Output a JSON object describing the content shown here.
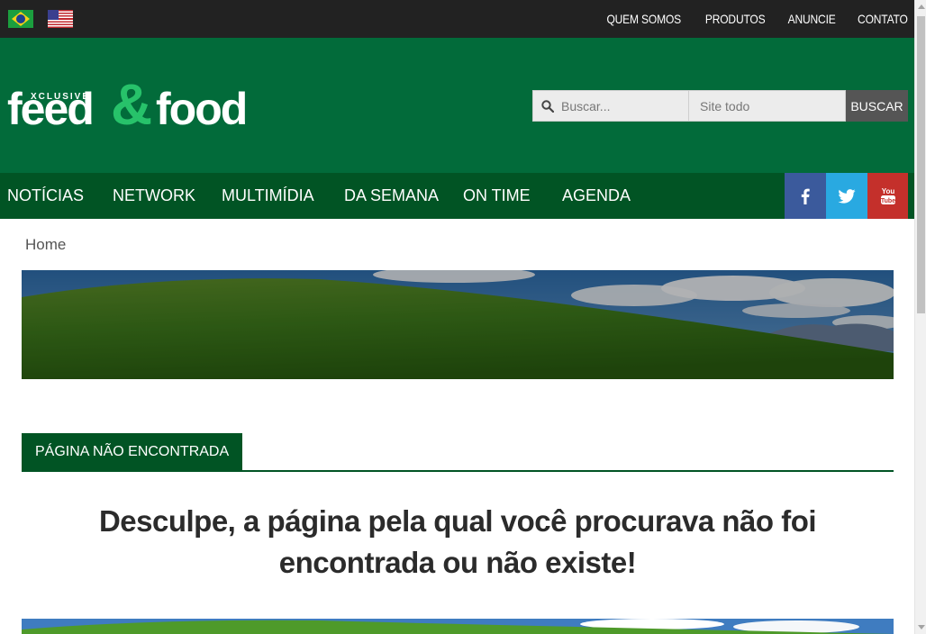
{
  "languages": [
    {
      "name": "flag-brazil-icon",
      "colors": {
        "green": "#1b9e3e",
        "yellow": "#f7d117",
        "blue": "#1e3f8f"
      }
    },
    {
      "name": "flag-usa-icon",
      "colors": {
        "red": "#c0272d",
        "blue": "#3a3f8f"
      }
    }
  ],
  "top_nav": [
    "QUEM SOMOS",
    "PRODUTOS",
    "ANUNCIE",
    "CONTATO"
  ],
  "logo": {
    "xclusive": "XCLUSIVE",
    "word1": "feed",
    "amp": "&",
    "word2": "food"
  },
  "search": {
    "placeholder": "Buscar...",
    "scope": "Site todo",
    "button": "BUSCAR"
  },
  "main_nav": [
    "NOTÍCIAS",
    "NETWORK",
    "MULTIMÍDIA",
    "DA SEMANA",
    "ON TIME",
    "AGENDA"
  ],
  "social": [
    {
      "name": "facebook-icon",
      "color": "#3b5a9c"
    },
    {
      "name": "twitter-icon",
      "color": "#29a9e1"
    },
    {
      "name": "youtube-icon",
      "color": "#c4302b"
    }
  ],
  "breadcrumb": "Home",
  "section_title": "PÁGINA NÃO ENCONTRADA",
  "message_line1": "Desculpe, a página pela qual você procurava não foi",
  "message_line2": "encontrada ou não existe!",
  "colors": {
    "topbar": "#222222",
    "header": "#026b3a",
    "nav": "#015424",
    "accent": "#27c26a"
  }
}
